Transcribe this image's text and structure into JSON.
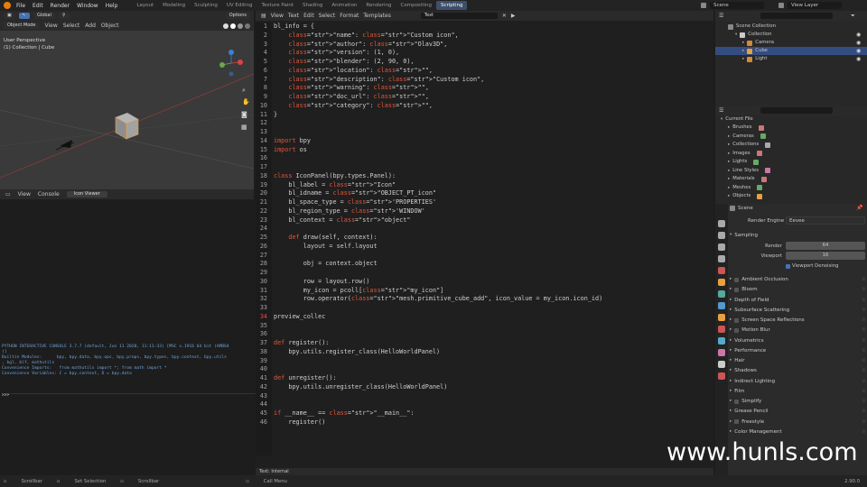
{
  "menu": [
    "File",
    "Edit",
    "Render",
    "Window",
    "Help"
  ],
  "workspaces": [
    "Layout",
    "Modeling",
    "Sculpting",
    "UV Editing",
    "Texture Paint",
    "Shading",
    "Animation",
    "Rendering",
    "Compositing",
    "Scripting"
  ],
  "active_workspace": "Scripting",
  "scene_name": "Scene",
  "view_layer": "View Layer",
  "viewport": {
    "header_items": [
      "Global",
      "Options"
    ],
    "mode": "Object Mode",
    "menus": [
      "View",
      "Select",
      "Add",
      "Object"
    ],
    "info_line1": "User Perspective",
    "info_line2": "(1) Collection | Cube"
  },
  "console": {
    "menus": [
      "View",
      "Console"
    ],
    "tab": "Icon Viewer",
    "lines": [
      "PYTHON INTERACTIVE CONSOLE 3.7.7 (default, Jun 11 2020, 11:11:33) [MSC v.1916 64 bit (AMD64",
      ")]",
      "",
      "Builtin Modules:      bpy, bpy.data, bpy.ops, bpy.props, bpy.types, bpy.context, bpy.utils",
      ", bgl, blf, mathutils",
      "Convenience Imports:   from mathutils import *; from math import *",
      "Convenience Variables: C = bpy.context, D = bpy.data"
    ],
    "prompt": ">>> "
  },
  "editor": {
    "menus": [
      "View",
      "Text",
      "Edit",
      "Select",
      "Format",
      "Templates"
    ],
    "text_name": "Text",
    "footer": "Text: Internal",
    "current_line": 34,
    "lines": [
      "bl_info = {",
      "    \"name\": \"Custom icon\",",
      "    \"author\": \"Olav3D\",",
      "    \"version\": (1, 0),",
      "    \"blender\": (2, 90, 0),",
      "    \"location\": \"\",",
      "    \"description\": \"Custom icon\",",
      "    \"warning\": \"\",",
      "    \"doc_url\": \"\",",
      "    \"category\": \"\",",
      "}",
      "",
      "",
      "import bpy",
      "import os",
      "",
      "",
      "class IconPanel(bpy.types.Panel):",
      "    bl_label = \"Icon\"",
      "    bl_idname = \"OBJECT_PT_icon\"",
      "    bl_space_type = 'PROPERTIES'",
      "    bl_region_type = 'WINDOW'",
      "    bl_context = \"object\"",
      "",
      "    def draw(self, context):",
      "        layout = self.layout",
      "",
      "        obj = context.object",
      "",
      "        row = layout.row()",
      "        my_icon = pcoll[\"my_icon\"]",
      "        row.operator(\"mesh.primitive_cube_add\", icon_value = my_icon.icon_id)",
      "",
      "preview_collec",
      "",
      "",
      "def register():",
      "    bpy.utils.register_class(HelloWorldPanel)",
      "",
      "",
      "def unregister():",
      "    bpy.utils.unregister_class(HelloWorldPanel)",
      "",
      "",
      "if __name__ == \"__main__\":",
      "    register()"
    ]
  },
  "outliner": {
    "root": "Scene Collection",
    "collection": "Collection",
    "items": [
      "Camera",
      "Cube",
      "Light"
    ],
    "selected": "Cube"
  },
  "blend_data": {
    "root": "Current File",
    "items": [
      "Brushes",
      "Cameras",
      "Collections",
      "Images",
      "Lights",
      "Line Styles",
      "Materials",
      "Meshes",
      "Objects"
    ]
  },
  "properties": {
    "scene": "Scene",
    "render_engine_label": "Render Engine",
    "render_engine": "Eevee",
    "sampling": "Sampling",
    "render_label": "Render",
    "render_value": "64",
    "viewport_label": "Viewport",
    "viewport_value": "16",
    "viewport_denoising": "Viewport Denoising",
    "sections": [
      {
        "label": "Ambient Occlusion",
        "check": true
      },
      {
        "label": "Bloom",
        "check": true
      },
      {
        "label": "Depth of Field",
        "check": false
      },
      {
        "label": "Subsurface Scattering",
        "check": false
      },
      {
        "label": "Screen Space Reflections",
        "check": true
      },
      {
        "label": "Motion Blur",
        "check": true
      },
      {
        "label": "Volumetrics",
        "check": false
      },
      {
        "label": "Performance",
        "check": false
      },
      {
        "label": "Hair",
        "check": false
      },
      {
        "label": "Shadows",
        "check": false
      },
      {
        "label": "Indirect Lighting",
        "check": false
      },
      {
        "label": "Film",
        "check": false
      },
      {
        "label": "Simplify",
        "check": true
      },
      {
        "label": "Grease Pencil",
        "check": false
      },
      {
        "label": "Freestyle",
        "check": true
      },
      {
        "label": "Color Management",
        "check": false
      }
    ]
  },
  "status": [
    "Scrollbar",
    "Set Selection",
    "Scrollbar",
    "Call Menu"
  ],
  "version": "2.90.0",
  "watermark": "www.hunls.com",
  "colors": {
    "accent": "#4772b3",
    "keyword": "#e2563b",
    "string": "#e3c176",
    "selected_row": "#334d80"
  }
}
